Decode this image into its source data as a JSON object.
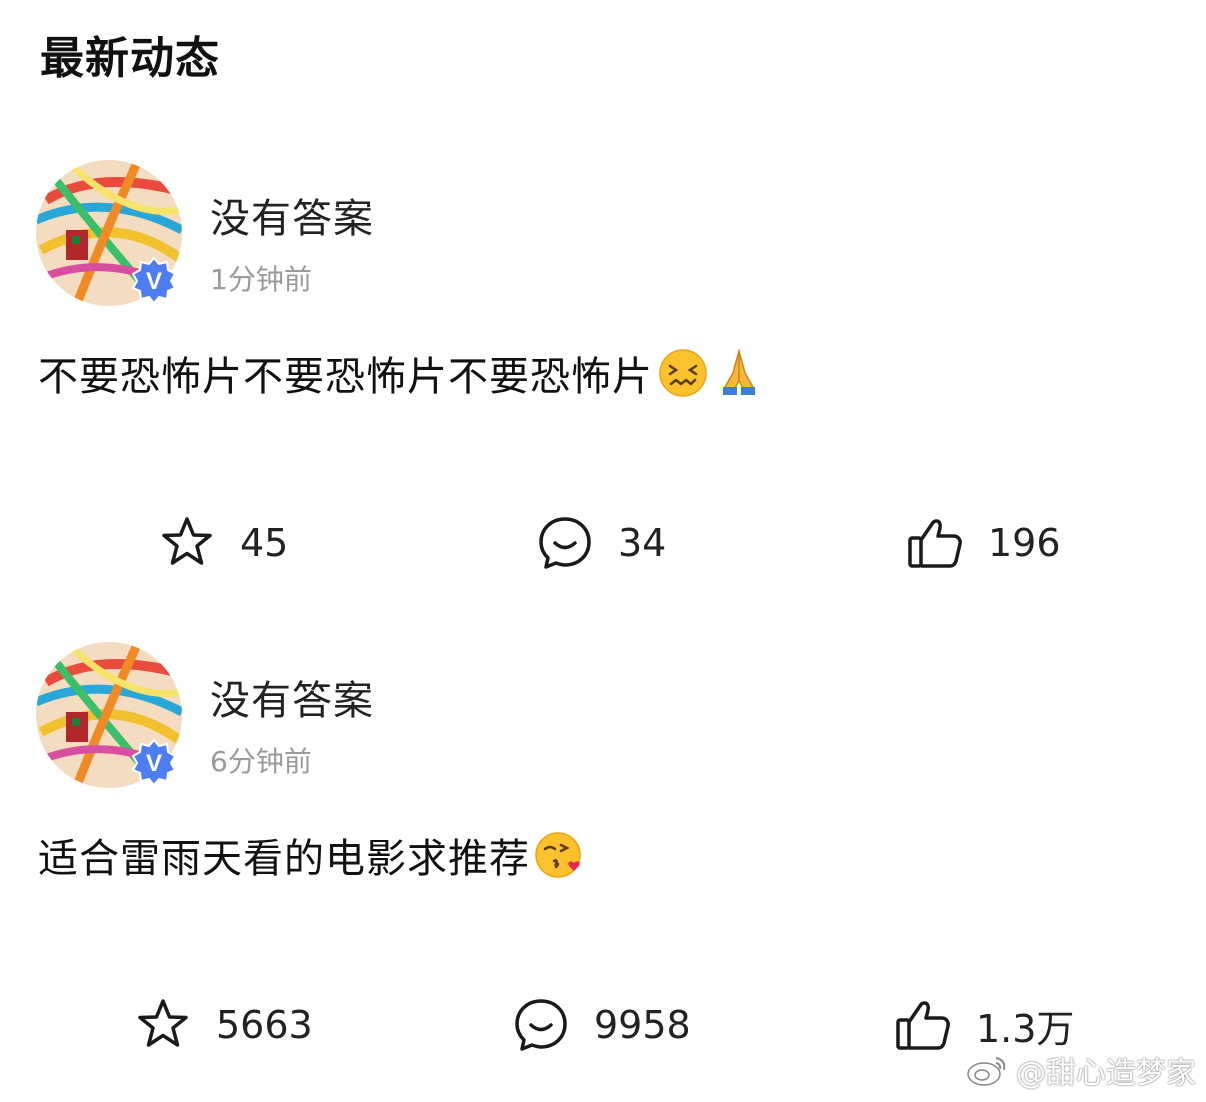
{
  "header": {
    "title": "最新动态"
  },
  "posts": [
    {
      "username": "没有答案",
      "timestamp": "1分钟前",
      "text": "不要恐怖片不要恐怖片不要恐怖片",
      "emojis": [
        "confounded-face",
        "folded-hands"
      ],
      "stats": {
        "favorites": "45",
        "comments": "34",
        "likes": "196"
      }
    },
    {
      "username": "没有答案",
      "timestamp": "6分钟前",
      "text": "适合雷雨天看的电影求推荐",
      "emojis": [
        "face-blowing-kiss"
      ],
      "stats": {
        "favorites": "5663",
        "comments": "9958",
        "likes": "1.3万"
      }
    }
  ],
  "watermark": {
    "text": "@甜心造梦家"
  },
  "icons": {
    "favorite": "star-outline-icon",
    "comment": "speech-bubble-icon",
    "like": "thumbs-up-icon",
    "verified": "verified-v-badge-icon"
  },
  "colors": {
    "text": "#111111",
    "muted": "#9a9a9a",
    "verified_badge": "#4e7df2"
  }
}
